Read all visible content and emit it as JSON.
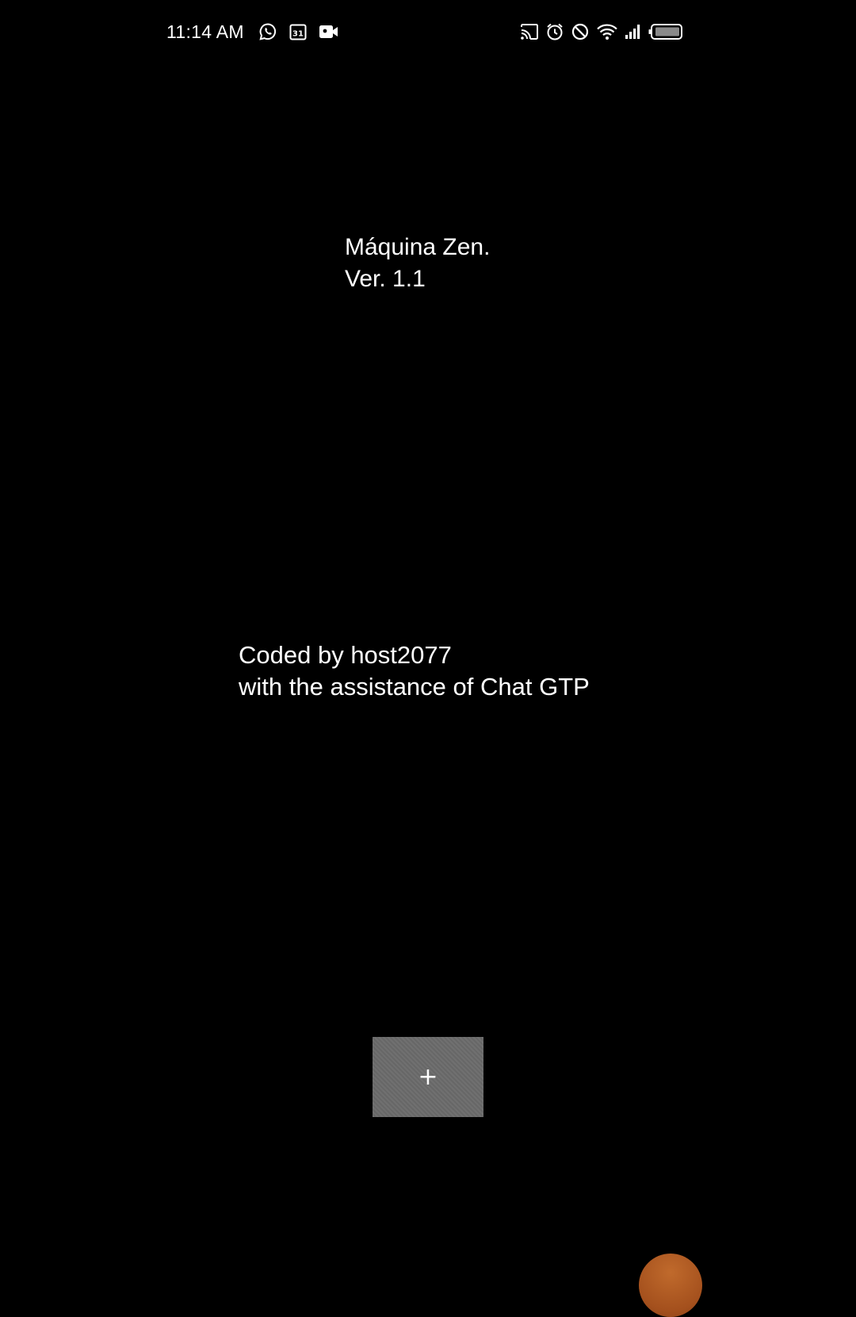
{
  "status_bar": {
    "time": "11:14 AM",
    "calendar_day": "31",
    "left_icons": [
      "whatsapp-icon",
      "calendar-icon",
      "video-camera-icon"
    ],
    "right_icons": [
      "cast-icon",
      "alarm-icon",
      "do-not-disturb-icon",
      "wifi-icon",
      "signal-icon",
      "battery-icon"
    ]
  },
  "app": {
    "title": "Máquina Zen.",
    "version": "Ver. 1.1"
  },
  "credits": {
    "line1": "Coded by host2077",
    "line2": "with the assistance of Chat GTP"
  },
  "plus_button": {
    "label": "+"
  },
  "colors": {
    "background": "#000000",
    "text": "#ffffff",
    "button": "#6b6b6b",
    "bubble": "#a4501d"
  }
}
